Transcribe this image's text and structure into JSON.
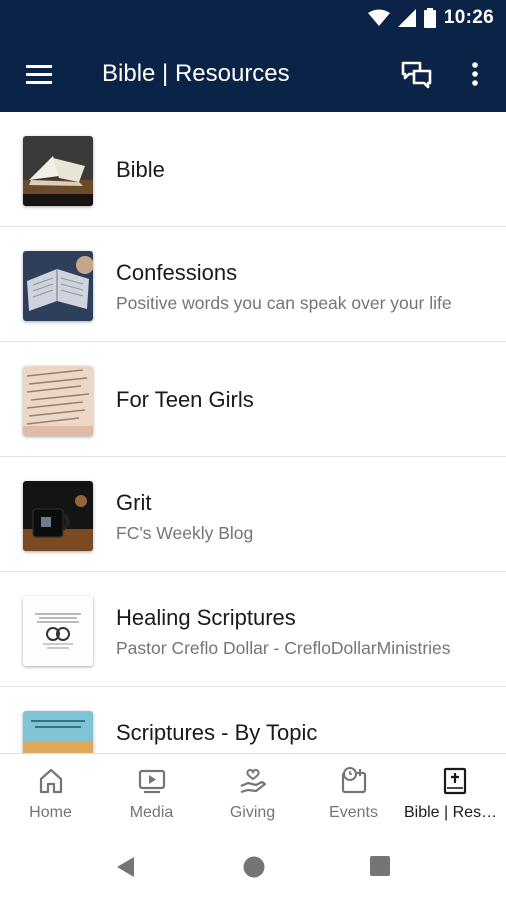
{
  "status": {
    "time": "10:26"
  },
  "appbar": {
    "title": "Bible | Resources"
  },
  "list": {
    "items": [
      {
        "title": "Bible",
        "subtitle": ""
      },
      {
        "title": "Confessions",
        "subtitle": "Positive words you can speak over your life"
      },
      {
        "title": "For Teen Girls",
        "subtitle": ""
      },
      {
        "title": "Grit",
        "subtitle": "FC's Weekly Blog"
      },
      {
        "title": "Healing Scriptures",
        "subtitle": "Pastor Creflo Dollar - CrefloDollarMinistries"
      },
      {
        "title": "Scriptures - By Topic",
        "subtitle": ""
      }
    ]
  },
  "nav": {
    "items": [
      {
        "label": "Home",
        "icon": "home-icon"
      },
      {
        "label": "Media",
        "icon": "media-icon"
      },
      {
        "label": "Giving",
        "icon": "giving-icon"
      },
      {
        "label": "Events",
        "icon": "events-icon"
      },
      {
        "label": "Bible | Resources",
        "icon": "bible-icon",
        "active": true
      }
    ]
  },
  "colors": {
    "appbar": "#0b2347",
    "text": "#1a1a1a",
    "muted": "#757575"
  }
}
